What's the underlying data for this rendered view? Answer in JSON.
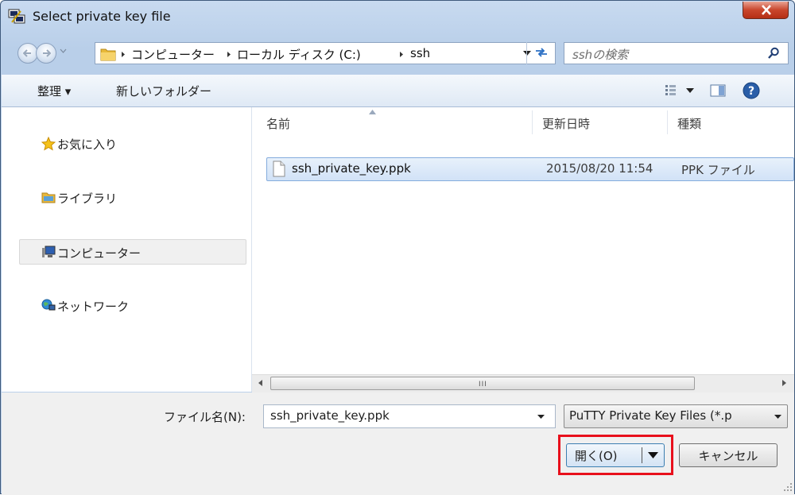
{
  "window": {
    "title": "Select private key file"
  },
  "address_bar": {
    "crumbs": [
      "コンピューター",
      "ローカル ディスク (C:)",
      "ssh"
    ],
    "search_placeholder": "sshの検索"
  },
  "toolbar": {
    "organize_label": "整理 ▾",
    "new_folder_label": "新しいフォルダー"
  },
  "nav_pane": {
    "items": [
      {
        "label": "お気に入り",
        "icon": "star-icon"
      },
      {
        "label": "ライブラリ",
        "icon": "library-icon"
      },
      {
        "label": "コンピューター",
        "icon": "computer-icon",
        "selected": true
      },
      {
        "label": "ネットワーク",
        "icon": "network-icon"
      }
    ]
  },
  "file_list": {
    "columns": [
      "名前",
      "更新日時",
      "種類"
    ],
    "rows": [
      {
        "name": "ssh_private_key.ppk",
        "modified": "2015/08/20 11:54",
        "type": "PPK ファイル",
        "selected": true
      }
    ],
    "scroll_grip": "III"
  },
  "bottom": {
    "filename_label": "ファイル名(N):",
    "filename_value": "ssh_private_key.ppk",
    "filetype_value": "PuTTY Private Key Files (*.p",
    "open_label": "開く(O)",
    "cancel_label": "キャンセル"
  },
  "colors": {
    "highlight": "#e8101c",
    "selection": "#d1e2f7"
  }
}
